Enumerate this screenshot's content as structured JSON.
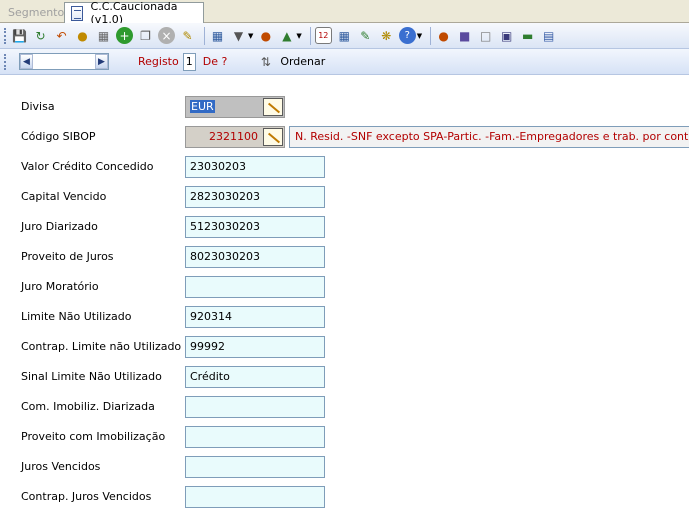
{
  "tabs": [
    {
      "label": "Segmento"
    },
    {
      "label": "C.C.Caucionada (v1.0)"
    }
  ],
  "toolbar": {
    "buttons": [
      "save-icon",
      "refresh-icon",
      "undo-icon",
      "users-icon",
      "printer-icon",
      "add-icon",
      "copy-icon",
      "delete-icon",
      "note-icon",
      "grid-icon",
      "filter-icon",
      "user-search-icon",
      "export-icon",
      "calendar-icon",
      "calculator-icon",
      "edit-icon",
      "settings-icon",
      "help-icon",
      "group-icon",
      "cube-icon",
      "window-icon",
      "book-icon",
      "link-icon",
      "document-icon"
    ]
  },
  "nav": {
    "registo_label": "Registo",
    "registo_value": "1",
    "de_label": "De ?",
    "ordenar_label": "Ordenar"
  },
  "form": {
    "divisa": {
      "label": "Divisa",
      "value": "EUR"
    },
    "codigo_sibop": {
      "label": "Código SIBOP",
      "value": "2321100",
      "description": "N. Resid. -SNF excepto SPA-Partic. -Fam.-Empregadores e trab. por conta própri"
    },
    "valor_credito": {
      "label": "Valor Crédito Concedido",
      "value": "23030203"
    },
    "capital_vencido": {
      "label": "Capital Vencido",
      "value": "2823030203"
    },
    "juro_diarizado": {
      "label": "Juro Diarizado",
      "value": "5123030203"
    },
    "proveito_juros": {
      "label": "Proveito de Juros",
      "value": "8023030203"
    },
    "juro_moratorio": {
      "label": "Juro Moratório",
      "value": ""
    },
    "limite_nao_utilizado": {
      "label": "Limite Não Utilizado",
      "value": "920314"
    },
    "contrap_limite": {
      "label": "Contrap. Limite não Utilizado",
      "value": "99992"
    },
    "sinal_limite": {
      "label": "Sinal Limite Não Utilizado",
      "value": "Crédito"
    },
    "com_imobiliz": {
      "label": "Com. Imobiliz. Diarizada",
      "value": ""
    },
    "proveito_imobilizacao": {
      "label": "Proveito com Imobilização",
      "value": ""
    },
    "juros_vencidos": {
      "label": "Juros Vencidos",
      "value": ""
    },
    "contrap_juros_vencidos": {
      "label": "Contrap. Juros Vencidos",
      "value": ""
    }
  }
}
